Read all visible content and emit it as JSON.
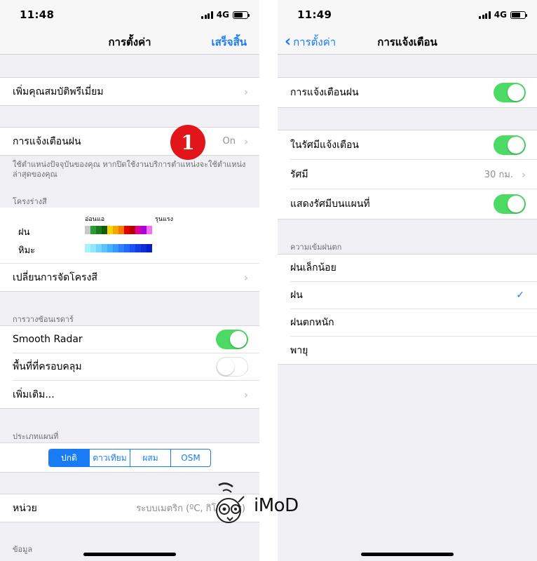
{
  "left": {
    "status": {
      "time": "11:48",
      "network": "4G"
    },
    "nav": {
      "title": "การตั้งค่า",
      "done": "เสร็จสิ้น"
    },
    "premium": {
      "label": "เพิ่มคุณสมบัติพรีเมี่ยม"
    },
    "rain_alert": {
      "label": "การแจ้งเตือนฝน",
      "value": "On"
    },
    "badge": "1",
    "location_note": "ใช้ตำแหน่งปัจจุบันของคุณ หากปิดใช้งานบริการตำแหน่งจะใช้ตำแหน่งล่าสุดของคุณ",
    "color_scheme": {
      "header": "โครงร่างสี",
      "weak": "อ่อนแอ",
      "strong": "รุนแรง",
      "rain": "ฝน",
      "snow": "หิมะ",
      "rain_colors": [
        "#c8c8c8",
        "#2a9d3a",
        "#1f7a1f",
        "#0f5c0f",
        "#f7d500",
        "#f7a800",
        "#f77a00",
        "#e00000",
        "#b80000",
        "#e0009c",
        "#a800d8",
        "#f56cf5"
      ],
      "snow_colors": [
        "#a6f2ff",
        "#8fe6ff",
        "#76d6ff",
        "#5cc3ff",
        "#45b0ff",
        "#3a98ff",
        "#2f80ff",
        "#2468ff",
        "#1b52f5",
        "#133ee6",
        "#0c2ed8",
        "#061fc9"
      ],
      "change_label": "เปลี่ยนการจัดโครงสี"
    },
    "radar": {
      "header": "การวางซ้อนเรดาร์",
      "smooth_label": "Smooth Radar",
      "smooth_on": true,
      "coverage_label": "พื้นที่ที่ครอบคลุม",
      "coverage_on": false,
      "more_label": "เพิ่มเติม..."
    },
    "map_type": {
      "header": "ประเภทแผนที่",
      "options": [
        "ปกติ",
        "ดาวเทียม",
        "ผสม",
        "OSM"
      ],
      "selected": "ปกติ"
    },
    "units": {
      "label": "หน่วย",
      "value": "ระบบเมตริก (ºC, กิโลเมตร)"
    },
    "data_header": "ข้อมูล"
  },
  "right": {
    "status": {
      "time": "11:49",
      "network": "4G"
    },
    "nav": {
      "back": "การตั้งค่า",
      "title": "การแจ้งเตือน"
    },
    "rain_alert": {
      "label": "การแจ้งเตือนฝน",
      "on": true
    },
    "in_radius": {
      "label": "ในรัศมีแจ้งเตือน",
      "on": true
    },
    "radius": {
      "label": "รัศมี",
      "value": "30 กม."
    },
    "show_radius": {
      "label": "แสดงรัศมีบนแผนที่",
      "on": true
    },
    "intensity": {
      "header": "ความเข้มฝนตก",
      "options": [
        "ฝนเล็กน้อย",
        "ฝน",
        "ฝนตกหนัก",
        "พายุ"
      ],
      "selected": "ฝน"
    }
  },
  "watermark": {
    "text": "iMoD"
  }
}
